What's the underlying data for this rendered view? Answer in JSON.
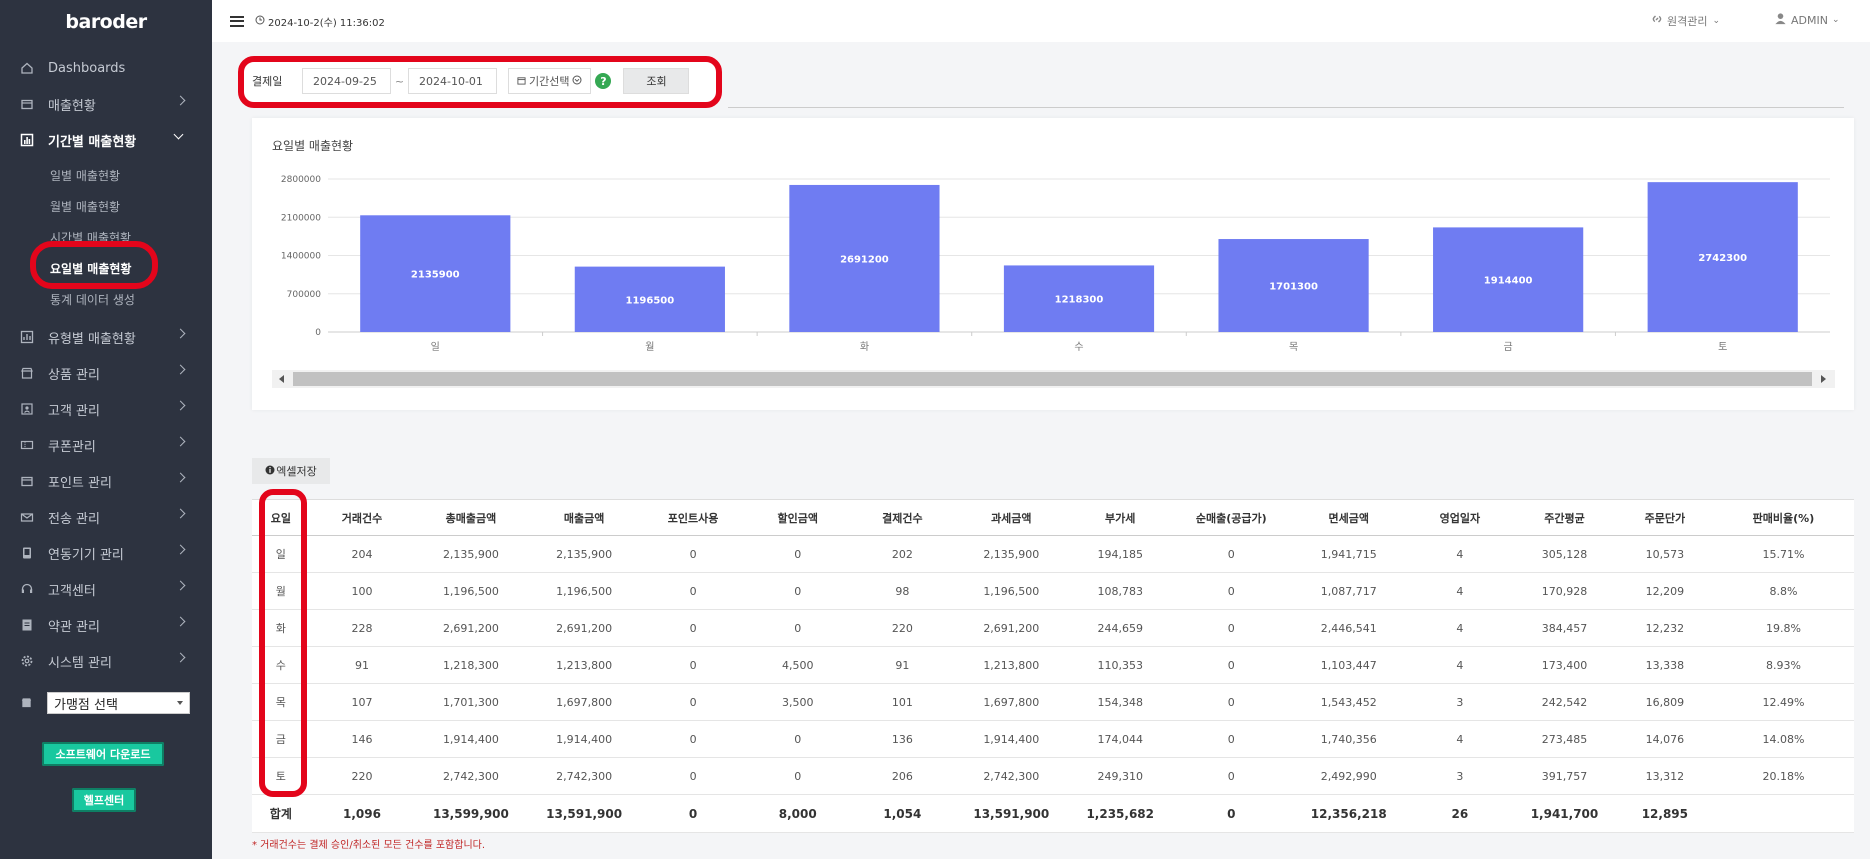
{
  "brand": {
    "name": "baroder"
  },
  "sidebar": {
    "dashboards": "Dashboards",
    "sales": "매출현황",
    "period_sales": "기간별 매출현황",
    "sub": [
      "일별 매출현황",
      "월별 매출현황",
      "시간별 매출현황",
      "요일별 매출현황",
      "통계 데이터 생성"
    ],
    "items": [
      "유형별 매출현황",
      "상품 관리",
      "고객 관리",
      "쿠폰관리",
      "포인트 관리",
      "전송 관리",
      "연동기기 관리",
      "고객센터",
      "약관 관리",
      "시스템 관리"
    ],
    "store_select": "가맹점 선택",
    "download_btn": "소프트웨어 다운로드",
    "help_btn": "헬프센터"
  },
  "topbar": {
    "datetime": "2024-10-2(수) 11:36:02",
    "remote": "원격관리",
    "user": "ADMIN"
  },
  "filter": {
    "label": "결제일",
    "start": "2024-09-25",
    "sep": "~",
    "end": "2024-10-01",
    "period": "기간선택",
    "help": "?",
    "query": "조회"
  },
  "chart_data": {
    "type": "bar",
    "title": "요일별 매출현황",
    "categories": [
      "일",
      "월",
      "화",
      "수",
      "목",
      "금",
      "토"
    ],
    "values": [
      2135900,
      1196500,
      2691200,
      1218300,
      1701300,
      1914400,
      2742300
    ],
    "yticks": [
      "2800000",
      "2100000",
      "1400000",
      "700000",
      "0"
    ],
    "ylim": [
      0,
      2800000
    ],
    "color": "#6f7cf2"
  },
  "excel": "엑셀저장",
  "table": {
    "headers": [
      "요일",
      "거래건수",
      "총매출금액",
      "매출금액",
      "포인트사용",
      "할인금액",
      "결제건수",
      "과세금액",
      "부가세",
      "순매출(공급가)",
      "면세금액",
      "영업일자",
      "주간평균",
      "주문단가",
      "판매비율(%)"
    ],
    "rows": [
      [
        "일",
        "204",
        "2,135,900",
        "2,135,900",
        "0",
        "0",
        "202",
        "2,135,900",
        "194,185",
        "0",
        "1,941,715",
        "4",
        "305,128",
        "10,573",
        "15.71%"
      ],
      [
        "월",
        "100",
        "1,196,500",
        "1,196,500",
        "0",
        "0",
        "98",
        "1,196,500",
        "108,783",
        "0",
        "1,087,717",
        "4",
        "170,928",
        "12,209",
        "8.8%"
      ],
      [
        "화",
        "228",
        "2,691,200",
        "2,691,200",
        "0",
        "0",
        "220",
        "2,691,200",
        "244,659",
        "0",
        "2,446,541",
        "4",
        "384,457",
        "12,232",
        "19.8%"
      ],
      [
        "수",
        "91",
        "1,218,300",
        "1,213,800",
        "0",
        "4,500",
        "91",
        "1,213,800",
        "110,353",
        "0",
        "1,103,447",
        "4",
        "173,400",
        "13,338",
        "8.93%"
      ],
      [
        "목",
        "107",
        "1,701,300",
        "1,697,800",
        "0",
        "3,500",
        "101",
        "1,697,800",
        "154,348",
        "0",
        "1,543,452",
        "3",
        "242,542",
        "16,809",
        "12.49%"
      ],
      [
        "금",
        "146",
        "1,914,400",
        "1,914,400",
        "0",
        "0",
        "136",
        "1,914,400",
        "174,044",
        "0",
        "1,740,356",
        "4",
        "273,485",
        "14,076",
        "14.08%"
      ],
      [
        "토",
        "220",
        "2,742,300",
        "2,742,300",
        "0",
        "0",
        "206",
        "2,742,300",
        "249,310",
        "0",
        "2,492,990",
        "3",
        "391,757",
        "13,312",
        "20.18%"
      ]
    ],
    "total": [
      "합계",
      "1,096",
      "13,599,900",
      "13,591,900",
      "0",
      "8,000",
      "1,054",
      "13,591,900",
      "1,235,682",
      "0",
      "12,356,218",
      "26",
      "1,941,700",
      "12,895",
      ""
    ]
  },
  "footnote": "* 거래건수는 결제 승인/취소된 모든 건수를 포함합니다."
}
